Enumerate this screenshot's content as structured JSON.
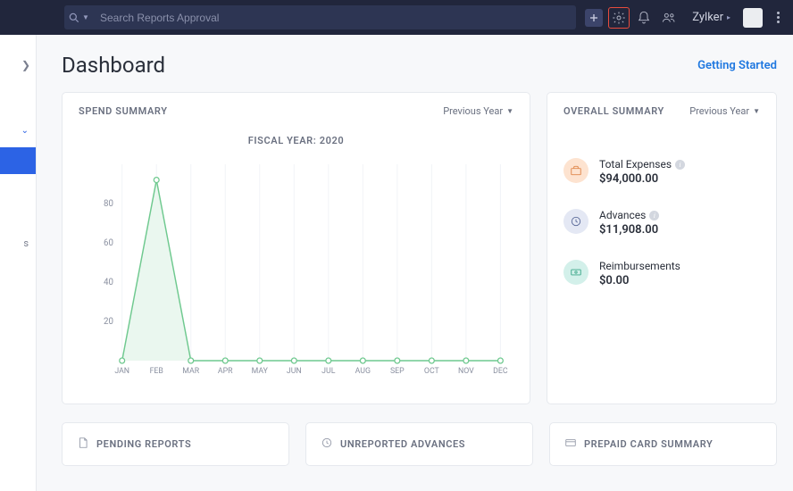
{
  "search": {
    "placeholder": "Search Reports Approval"
  },
  "org_name": "Zylker",
  "page_title": "Dashboard",
  "getting_started": "Getting Started",
  "spend": {
    "title": "SPEND SUMMARY",
    "dropdown": "Previous Year",
    "chart_title": "FISCAL YEAR: 2020"
  },
  "overall": {
    "title": "OVERALL SUMMARY",
    "dropdown": "Previous Year",
    "total_expenses_label": "Total Expenses",
    "total_expenses_value": "$94,000.00",
    "advances_label": "Advances",
    "advances_value": "$11,908.00",
    "reimbursements_label": "Reimbursements",
    "reimbursements_value": "$0.00"
  },
  "lower": {
    "pending": "PENDING REPORTS",
    "unreported": "UNREPORTED ADVANCES",
    "prepaid": "PREPAID CARD SUMMARY"
  },
  "chart_data": {
    "type": "line",
    "title": "FISCAL YEAR: 2020",
    "x": [
      "JAN",
      "FEB",
      "MAR",
      "APR",
      "MAY",
      "JUN",
      "JUL",
      "AUG",
      "SEP",
      "OCT",
      "NOV",
      "DEC"
    ],
    "values": [
      0,
      92,
      0,
      0,
      0,
      0,
      0,
      0,
      0,
      0,
      0,
      0
    ],
    "y_ticks": [
      20,
      40,
      60,
      80
    ],
    "ylim": [
      0,
      100
    ],
    "xlabel": "",
    "ylabel": ""
  }
}
